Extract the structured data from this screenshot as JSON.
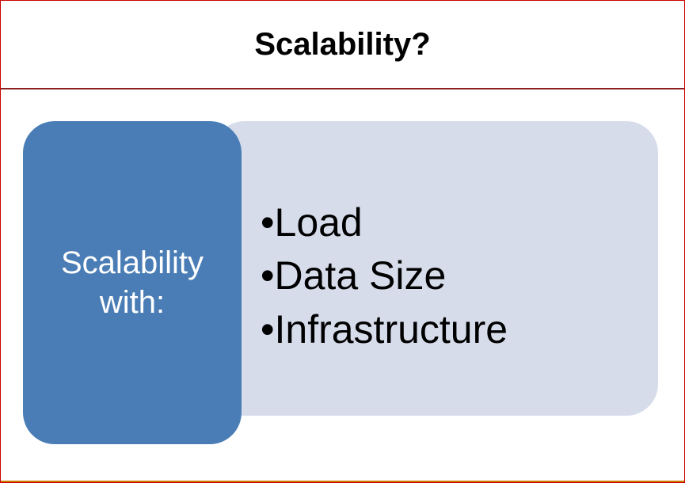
{
  "slide": {
    "title": "Scalability?",
    "label_line1": "Scalability",
    "label_line2": "with:",
    "bullets": {
      "item1": "•Load",
      "item2": "•Data Size",
      "item3": "•Infrastructure"
    }
  }
}
